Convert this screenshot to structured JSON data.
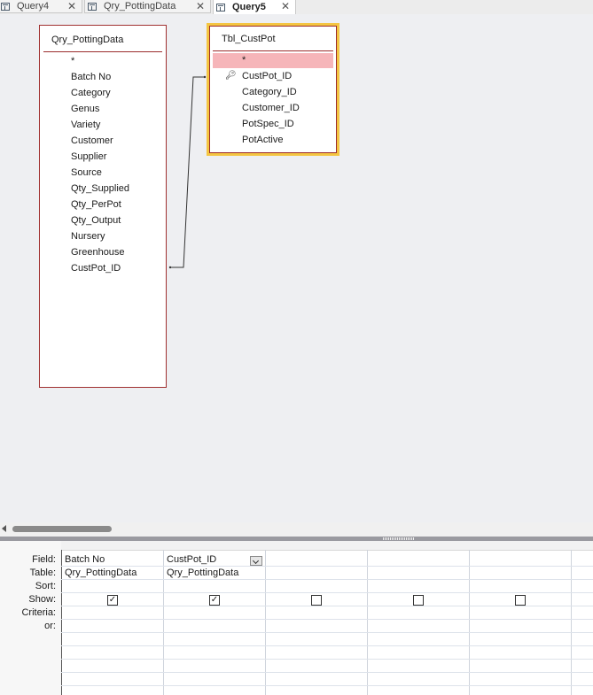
{
  "tabs": [
    {
      "label": "Query4",
      "close": "✕"
    },
    {
      "label": "Qry_PottingData",
      "close": "✕"
    },
    {
      "label": "Query5",
      "close": "✕"
    }
  ],
  "tables": [
    {
      "title": "Qry_PottingData",
      "fields": [
        "*",
        "Batch No",
        "Category",
        "Genus",
        "Variety",
        "Customer",
        "Supplier",
        "Source",
        "Qty_Supplied",
        "Qty_PerPot",
        "Qty_Output",
        "Nursery",
        "Greenhouse",
        "CustPot_ID"
      ]
    },
    {
      "title": "Tbl_CustPot",
      "fields": [
        "*",
        "CustPot_ID",
        "Category_ID",
        "Customer_ID",
        "PotSpec_ID",
        "PotActive"
      ]
    }
  ],
  "grid": {
    "row_labels": [
      "Field:",
      "Table:",
      "Sort:",
      "Show:",
      "Criteria:",
      "or:"
    ],
    "columns": [
      {
        "field": "Batch No",
        "table": "Qry_PottingData",
        "show": true
      },
      {
        "field": "CustPot_ID",
        "table": "Qry_PottingData",
        "show": true
      },
      {
        "field": "",
        "table": "",
        "show": false
      },
      {
        "field": "",
        "table": "",
        "show": false
      },
      {
        "field": "",
        "table": "",
        "show": false
      }
    ]
  }
}
